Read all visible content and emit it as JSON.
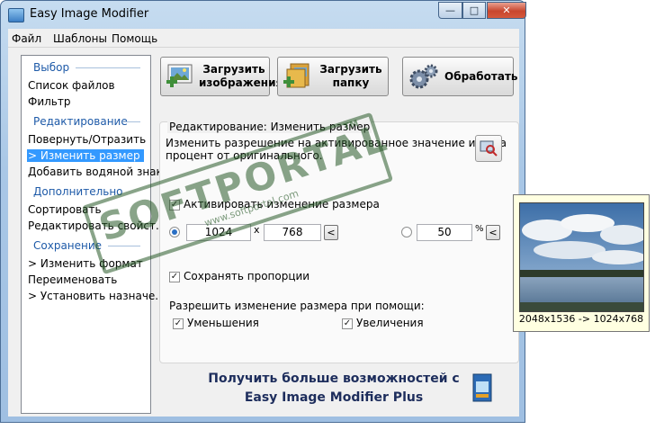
{
  "window": {
    "title": "Easy Image Modifier",
    "min": "—",
    "max": "□",
    "close": "✕"
  },
  "menu": [
    "Файл",
    "Шаблоны",
    "Помощь"
  ],
  "sidebar": {
    "sections": [
      {
        "title": "Выбор",
        "items": [
          "Список файлов",
          "Фильтр"
        ]
      },
      {
        "title": "Редактирование",
        "items": [
          "Повернуть/Отразить",
          "> Изменить размер",
          "Добавить водяной знак"
        ]
      },
      {
        "title": "Дополнительно",
        "items": [
          "Сортировать",
          "Редактировать свойст..."
        ]
      },
      {
        "title": "Сохранение",
        "items": [
          "> Изменить формат",
          "Переименовать",
          "> Установить назначе..."
        ]
      }
    ],
    "selected": "> Изменить размер"
  },
  "toolbar": {
    "load_images": [
      "Загрузить",
      "изображения"
    ],
    "load_folder": [
      "Загрузить",
      "папку"
    ],
    "process": "Обработать"
  },
  "panel": {
    "title": "Редактирование: Изменить размер",
    "description": [
      "Изменить разрешение на активированное значение или на",
      "процент от оригинального."
    ],
    "activate_label": "Активировать изменение размера",
    "width": "1024",
    "x_sep": "x",
    "height": "768",
    "percent": "50",
    "percent_sign": "%",
    "arrow": "<",
    "keep_ratio": "Сохранять пропорции",
    "allow_title": "Разрешить изменение размера при помощи:",
    "reduce": "Уменьшения",
    "enlarge": "Увеличения",
    "check": "✓"
  },
  "promo": {
    "line1": "Получить больше возможностей с",
    "line2": "Easy Image Modifier Plus"
  },
  "watermark": {
    "main": "SOFTPORTAL",
    "sub": "www.softportal.com",
    "tm": "TM"
  },
  "preview": {
    "caption": "2048x1536 -> 1024x768"
  }
}
